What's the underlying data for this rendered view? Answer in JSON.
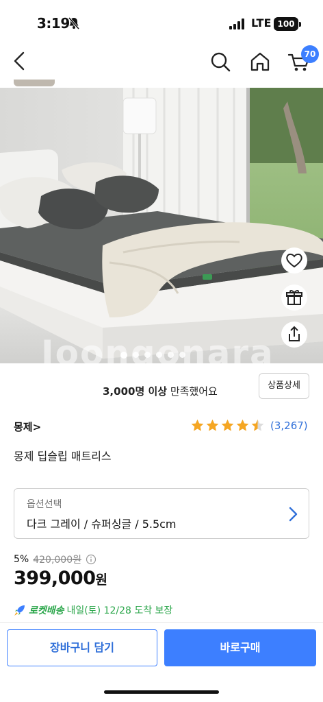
{
  "status_bar": {
    "time": "3:19",
    "network": "LTE",
    "battery": "100"
  },
  "nav": {
    "cart_count": "70"
  },
  "hero": {
    "watermark": "Joongonara",
    "dot_count": 6,
    "active_dot": 0
  },
  "satisfaction": {
    "count_text": "3,000명 이상",
    "suffix": "만족했어요"
  },
  "detail_button": "상품상세",
  "brand": "몽제",
  "brand_chevron": ">",
  "rating": {
    "stars": 4.5,
    "count": "(3,267)"
  },
  "product_name": "몽제 딥슬립 매트리스",
  "option": {
    "label": "옵션선택",
    "value": "다크 그레이 / 슈퍼싱글 / 5.5cm"
  },
  "price": {
    "discount": "5%",
    "original": "420,000원",
    "sale": "399,000",
    "currency": "원"
  },
  "delivery": {
    "label": "로켓배송",
    "text": "내일(토) 12/28 도착 보장"
  },
  "buttons": {
    "cart": "장바구니 담기",
    "buy": "바로구매"
  },
  "colors": {
    "accent": "#3d7fff",
    "star": "#f5a623",
    "rocket_green": "#2aa64a"
  }
}
